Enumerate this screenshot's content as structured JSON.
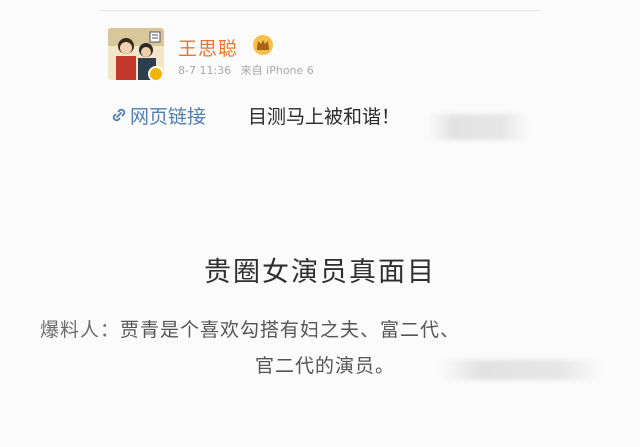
{
  "post": {
    "username": "王思聪",
    "meta": {
      "date_time": "8-7 11:36",
      "source": "来自 iPhone 6"
    },
    "link_text": "网页链接",
    "text": "目测马上被和谐！"
  },
  "article": {
    "title": "贵圈女演员真面目",
    "reveal_label": "爆料人：",
    "reveal_line1": "贾青是个喜欢勾搭有妇之夫、富二代、",
    "reveal_line2": "官二代的演员。"
  },
  "icons": {
    "avatar": "user-avatar-cartoon",
    "verified": "verified-badge-icon",
    "vip": "vip-crown-icon",
    "link": "link-icon"
  },
  "colors": {
    "username": "#e8782c",
    "link": "#4f7fb1",
    "meta": "#a8a8a8",
    "body_text": "#555555"
  }
}
